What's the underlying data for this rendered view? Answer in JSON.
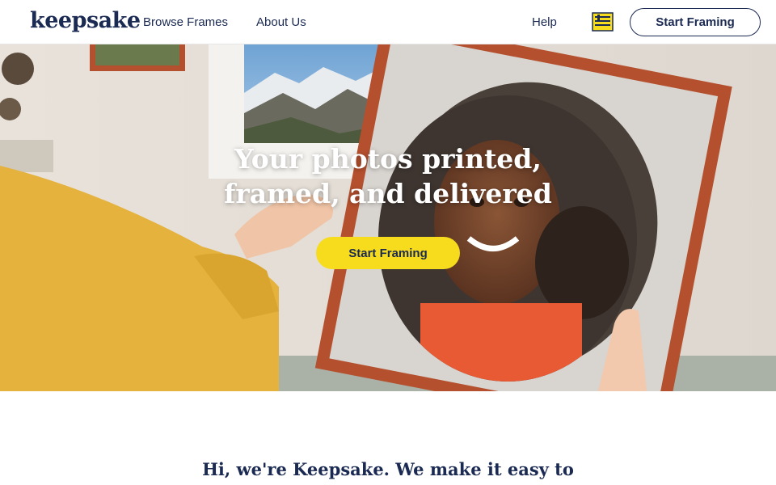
{
  "header": {
    "logo_text": "keepsake",
    "nav": {
      "browse_frames": "Browse Frames",
      "about_us": "About Us",
      "help": "Help"
    },
    "cart_icon": "cart-icon",
    "cta_label": "Start Framing"
  },
  "hero": {
    "title_line1": "Your photos printed,",
    "title_line2": "framed, and delivered",
    "cta_label": "Start Framing"
  },
  "intro": {
    "text": "Hi, we're Keepsake. We make it easy to"
  },
  "colors": {
    "navy": "#1b2a52",
    "cta_yellow": "#f7dc1d",
    "frame_wood": "#b5502e"
  }
}
